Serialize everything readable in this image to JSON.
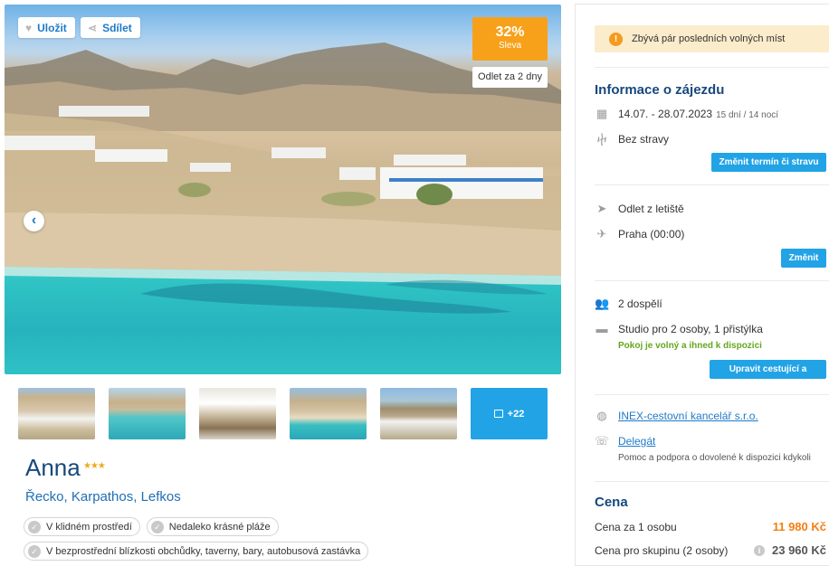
{
  "gallery": {
    "save_label": "Uložit",
    "share_label": "Sdílet",
    "discount_percent": "32%",
    "discount_label": "Sleva",
    "departure_badge": "Odlet za 2 dny",
    "more_photos": "+22"
  },
  "hotel": {
    "name": "Anna",
    "stars": 3,
    "star_glyphs": "★★★",
    "location": "Řecko, Karpathos, Lefkos",
    "tags": [
      "V klidném prostředí",
      "Nedaleko krásné pláže",
      "V bezprostřední blízkosti obchůdky, taverny, bary, autobusová zastávka"
    ]
  },
  "panel": {
    "alert": "Zbývá pár posledních volných míst",
    "trip_info_title": "Informace o zájezdu",
    "dates": "14.07. - 28.07.2023",
    "duration": "15 dní / 14 nocí",
    "board": "Bez stravy",
    "change_date_button": "Změnit termín či stravu",
    "departure_label": "Odlet z letiště",
    "departure_airport": "Praha (00:00)",
    "change_button": "Změnit",
    "travelers": "2 dospělí",
    "room": "Studio pro 2 osoby, 1 přistýlka",
    "room_status": "Pokoj je volný a ihned k dispozici",
    "edit_travelers_button": "Upravit cestující a pokoj",
    "agency": "INEX-cestovní kancelář s.r.o.",
    "delegate": "Delegát",
    "delegate_note": "Pomoc a podpora o dovolené k dispozici kdykoli",
    "price_title": "Cena",
    "price_per_person_label": "Cena za 1 osobu",
    "price_per_person": "11 980 Kč",
    "price_group_label": "Cena pro skupinu (2 osoby)",
    "price_group": "23 960 Kč"
  },
  "colors": {
    "accent_blue": "#22a3e6",
    "discount_orange": "#f7a11a",
    "title_navy": "#17487d",
    "price_orange": "#f47e11",
    "success_green": "#66a61f"
  },
  "icons": {
    "save": "heart-icon",
    "share": "share-icon",
    "dates": "calendar-icon",
    "board": "cutlery-icon",
    "departure": "plane-takeoff-icon",
    "airport": "plane-icon",
    "travelers": "users-icon",
    "room": "bed-icon",
    "agency": "globe-icon",
    "delegate": "delegate-icon"
  }
}
